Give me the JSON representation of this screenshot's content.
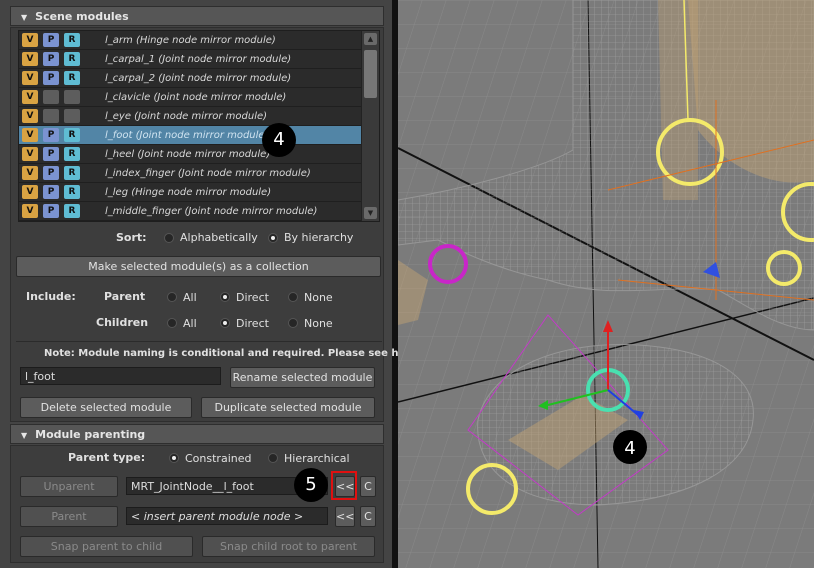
{
  "scene_modules": {
    "header": "Scene modules",
    "items": [
      {
        "label": "l_arm (Hinge node mirror module)",
        "v": "V",
        "p": "P",
        "r": "R",
        "pr_on": true
      },
      {
        "label": "l_carpal_1 (Joint node mirror module)",
        "v": "V",
        "p": "P",
        "r": "R",
        "pr_on": true
      },
      {
        "label": "l_carpal_2 (Joint node mirror module)",
        "v": "V",
        "p": "P",
        "r": "R",
        "pr_on": true
      },
      {
        "label": "l_clavicle (Joint node mirror module)",
        "v": "V",
        "p": "",
        "r": "",
        "pr_on": false
      },
      {
        "label": "l_eye (Joint node mirror module)",
        "v": "V",
        "p": "",
        "r": "",
        "pr_on": false
      },
      {
        "label": "l_foot (Joint node mirror module)",
        "v": "V",
        "p": "P",
        "r": "R",
        "pr_on": true,
        "selected": true
      },
      {
        "label": "l_heel (Joint node mirror module)",
        "v": "V",
        "p": "P",
        "r": "R",
        "pr_on": true
      },
      {
        "label": "l_index_finger (Joint node mirror module)",
        "v": "V",
        "p": "P",
        "r": "R",
        "pr_on": true
      },
      {
        "label": "l_leg (Hinge node mirror module)",
        "v": "V",
        "p": "P",
        "r": "R",
        "pr_on": true
      },
      {
        "label": "l_middle_finger (Joint node mirror module)",
        "v": "V",
        "p": "P",
        "r": "R",
        "pr_on": true
      }
    ],
    "sort_label": "Sort:",
    "sort_alpha": "Alphabetically",
    "sort_hier": "By hierarchy",
    "sort_selected": "By hierarchy",
    "collection_button": "Make selected module(s) as a collection",
    "include_label": "Include:",
    "parent_label": "Parent",
    "children_label": "Children",
    "opt_all": "All",
    "opt_direct": "Direct",
    "opt_none": "None",
    "parent_selected": "Direct",
    "children_selected": "Direct",
    "note": "Note: Module naming is conditional and required. Please see help.",
    "name_value": "l_foot",
    "rename_button": "Rename selected module",
    "delete_button": "Delete selected module",
    "duplicate_button": "Duplicate selected module"
  },
  "module_parenting": {
    "header": "Module parenting",
    "parent_type_label": "Parent type:",
    "constrained": "Constrained",
    "hierarchical": "Hierarchical",
    "parent_type_selected": "Constrained",
    "unparent_button": "Unparent",
    "current_parent_value": "MRT_JointNode__l_foot",
    "arrow_button": "<<",
    "clear_button": "C",
    "parent_button": "Parent",
    "parent_placeholder": "< insert parent module node >",
    "snap_parent_button": "Snap parent to child",
    "snap_child_button": "Snap child root to parent"
  },
  "callouts": {
    "list": "4",
    "viewport": "4",
    "arrow": "5"
  },
  "colors": {
    "accent_selection": "#5285a6",
    "v_button": "#d9a343",
    "p_button": "#7b93d1",
    "r_button": "#5fbcd3",
    "highlight_box": "#e01010"
  }
}
